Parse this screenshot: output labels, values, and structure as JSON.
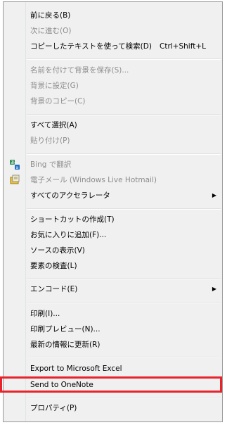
{
  "menu": {
    "back": "前に戻る(B)",
    "forward": "次に進む(O)",
    "copy_search": "コピーしたテキストを使って検索(D)",
    "copy_search_shortcut": "Ctrl+Shift+L",
    "save_bg": "名前を付けて背景を保存(S)...",
    "set_bg": "背景に設定(G)",
    "copy_bg": "背景のコピー(C)",
    "select_all": "すべて選択(A)",
    "paste": "貼り付け(P)",
    "bing_translate": "Bing で翻訳",
    "email": "電子メール (Windows Live Hotmail)",
    "all_accelerators": "すべてのアクセラレータ",
    "create_shortcut": "ショートカットの作成(T)",
    "add_favorites": "お気に入りに追加(F)...",
    "view_source": "ソースの表示(V)",
    "inspect": "要素の検査(L)",
    "encoding": "エンコード(E)",
    "print": "印刷(I)...",
    "print_preview": "印刷プレビュー(N)...",
    "refresh": "最新の情報に更新(R)",
    "export_excel": "Export to Microsoft Excel",
    "send_onenote": "Send to OneNote",
    "properties": "プロパティ(P)"
  },
  "icons": {
    "bing": "bing-translate-icon",
    "email": "email-icon",
    "submenu": "submenu-arrow-icon"
  },
  "colors": {
    "menu_bg": "#f0f0f0",
    "disabled_text": "#8d8d8d",
    "highlight_border": "#e8232b"
  }
}
